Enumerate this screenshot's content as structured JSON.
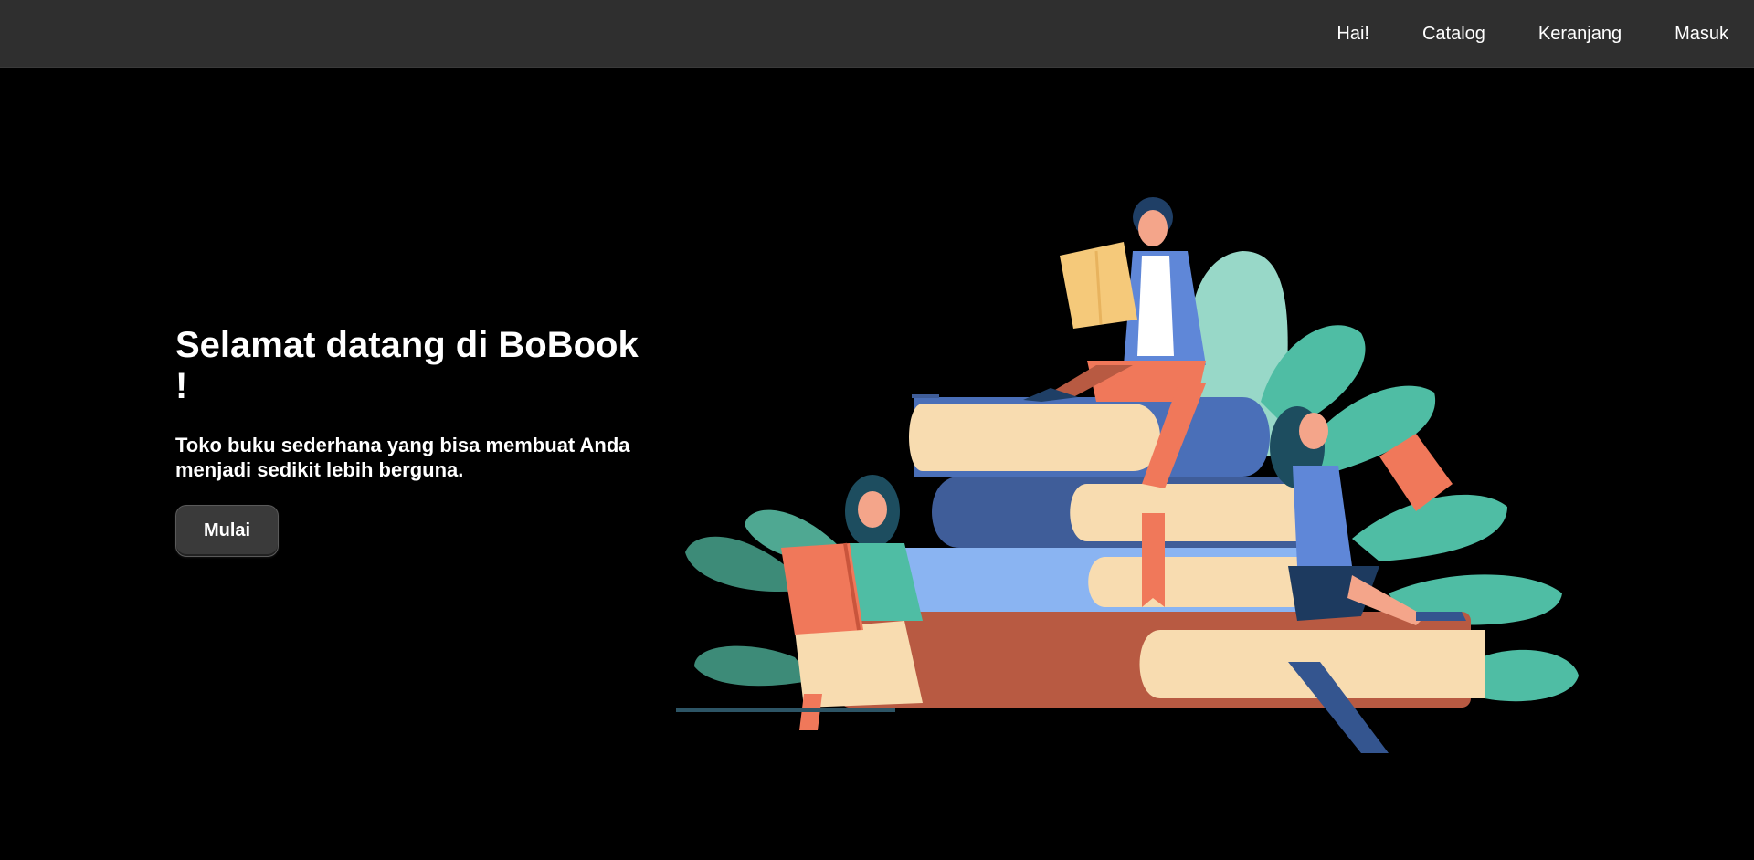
{
  "nav": {
    "items": [
      "Hai!",
      "Catalog",
      "Keranjang",
      "Masuk"
    ]
  },
  "hero": {
    "title": "Selamat datang di BoBook !",
    "subtitle": "Toko buku sederhana yang bisa membuat Anda menjadi sedikit lebih berguna.",
    "cta_label": "Mulai"
  },
  "colors": {
    "background": "#000000",
    "topbar": "#2f2f2f",
    "button": "#3a3a3a",
    "text": "#ffffff"
  },
  "icons": {
    "illustration": "people-reading-on-books-illustration"
  }
}
